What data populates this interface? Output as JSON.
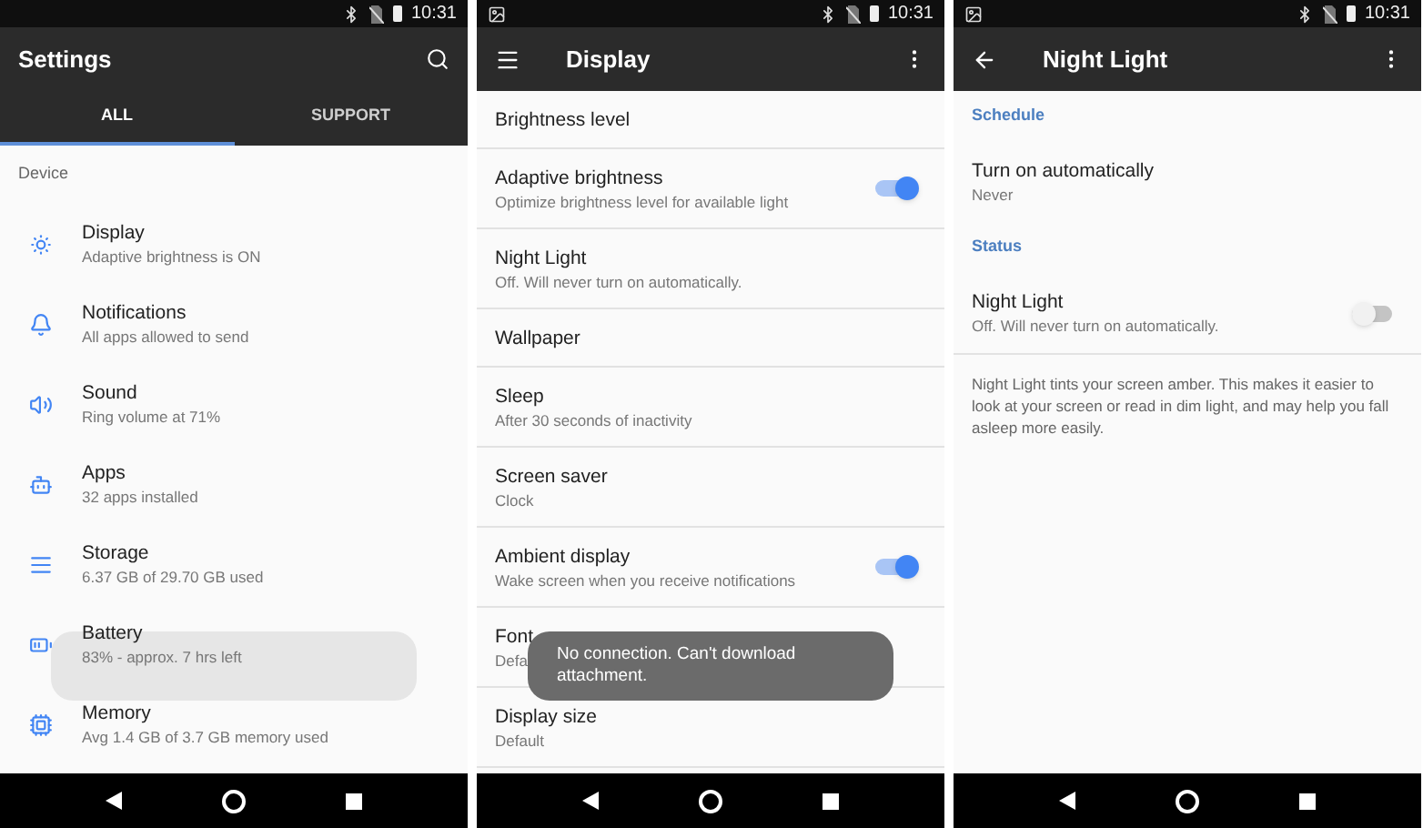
{
  "phones": [
    {
      "status_bar": {
        "time": "10:31",
        "notification": false
      },
      "toolbar": {
        "title": "Settings"
      },
      "tabs": [
        {
          "label": "ALL",
          "selected": true
        },
        {
          "label": "SUPPORT",
          "selected": false
        }
      ],
      "rows": [
        {
          "kind": "header",
          "text": "Device"
        },
        {
          "kind": "icon_item",
          "title": "Display",
          "subtitle": "Adaptive brightness is ON"
        },
        {
          "kind": "icon_item",
          "title": "Notifications",
          "subtitle": "All apps allowed to send"
        },
        {
          "kind": "icon_item",
          "title": "Sound",
          "subtitle": "Ring volume at 71%"
        },
        {
          "kind": "icon_item",
          "title": "Apps",
          "subtitle": "32 apps installed"
        },
        {
          "kind": "icon_item",
          "title": "Storage",
          "subtitle": "6.37 GB of 29.70 GB used"
        },
        {
          "kind": "icon_item",
          "title": "Battery",
          "subtitle": "83% - approx. 7 hrs left"
        },
        {
          "kind": "icon_item",
          "title": "Memory",
          "subtitle": "Avg 1.4 GB of 3.7 GB memory used"
        }
      ],
      "toast": {
        "faded": true
      }
    },
    {
      "status_bar": {
        "time": "10:31",
        "notification": true
      },
      "toolbar": {
        "title": "Display"
      },
      "rows": [
        {
          "kind": "item",
          "title": "Brightness level"
        },
        {
          "kind": "item",
          "title": "Adaptive brightness",
          "subtitle": "Optimize brightness level for available light",
          "switch": {
            "on": true
          }
        },
        {
          "kind": "item",
          "title": "Night Light",
          "subtitle": "Off. Will never turn on automatically."
        },
        {
          "kind": "item",
          "title": "Wallpaper"
        },
        {
          "kind": "item",
          "title": "Sleep",
          "subtitle": "After 30 seconds of inactivity"
        },
        {
          "kind": "item",
          "title": "Screen saver",
          "subtitle": "Clock"
        },
        {
          "kind": "item",
          "title": "Ambient display",
          "subtitle": "Wake screen when you receive notifications",
          "switch": {
            "on": true
          }
        },
        {
          "kind": "item",
          "title": "Font",
          "subtitle": "Defa"
        },
        {
          "kind": "item",
          "title": "Display size",
          "subtitle": "Default"
        }
      ],
      "toast": {
        "text": "No connection. Can't download attachment.",
        "faded": false
      }
    },
    {
      "status_bar": {
        "time": "10:31",
        "notification": true
      },
      "toolbar": {
        "title": "Night Light"
      },
      "rows": [
        {
          "kind": "header",
          "text": "Schedule"
        },
        {
          "kind": "plain_item",
          "title": "Turn on automatically",
          "subtitle": "Never"
        },
        {
          "kind": "header",
          "text": "Status"
        },
        {
          "kind": "plain_item",
          "title": "Night Light",
          "subtitle": "Off. Will never turn on automatically.",
          "switch": {
            "on": false
          }
        },
        {
          "kind": "note",
          "text": "Night Light tints your screen amber. This makes it easier to look at your screen or read in dim light, and may help you fall asleep more easily."
        }
      ]
    }
  ]
}
